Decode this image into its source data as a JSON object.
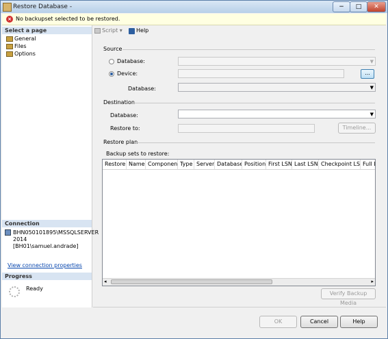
{
  "window": {
    "title": "Restore Database -",
    "min": "−",
    "max": "□",
    "close": "✕"
  },
  "message": "No backupset selected to be restored.",
  "left": {
    "select_page_heading": "Select a page",
    "pages": [
      {
        "label": "General"
      },
      {
        "label": "Files"
      },
      {
        "label": "Options"
      }
    ],
    "connection_heading": "Connection",
    "connection_text_line1": "BHN050101895\\MSSQLSERVER",
    "connection_text_line2": "2014 [BH01\\samuel.andrade]",
    "view_connection_link": "View connection properties",
    "progress_heading": "Progress",
    "progress_status": "Ready"
  },
  "toolbar": {
    "script": "Script",
    "script_arrow": "▾",
    "help": "Help"
  },
  "source": {
    "heading": "Source",
    "database_label": "Database:",
    "device_label": "Device:",
    "device_button": "...",
    "database2_label": "Database:",
    "selected_option": "Device"
  },
  "destination": {
    "heading": "Destination",
    "database_label": "Database:",
    "restore_to_label": "Restore to:",
    "timeline_button": "Timeline..."
  },
  "restore_plan": {
    "heading": "Restore plan",
    "backup_sets_label": "Backup sets to restore:",
    "columns": [
      "Restore",
      "Name",
      "Component",
      "Type",
      "Server",
      "Database",
      "Position",
      "First LSN",
      "Last LSN",
      "Checkpoint LSN",
      "Full LS"
    ],
    "verify_button": "Verify Backup Media"
  },
  "buttons": {
    "ok": "OK",
    "cancel": "Cancel",
    "help": "Help"
  },
  "colors": {
    "accent": "#3c7fb1",
    "error": "#d03030",
    "link": "#0645ad"
  }
}
